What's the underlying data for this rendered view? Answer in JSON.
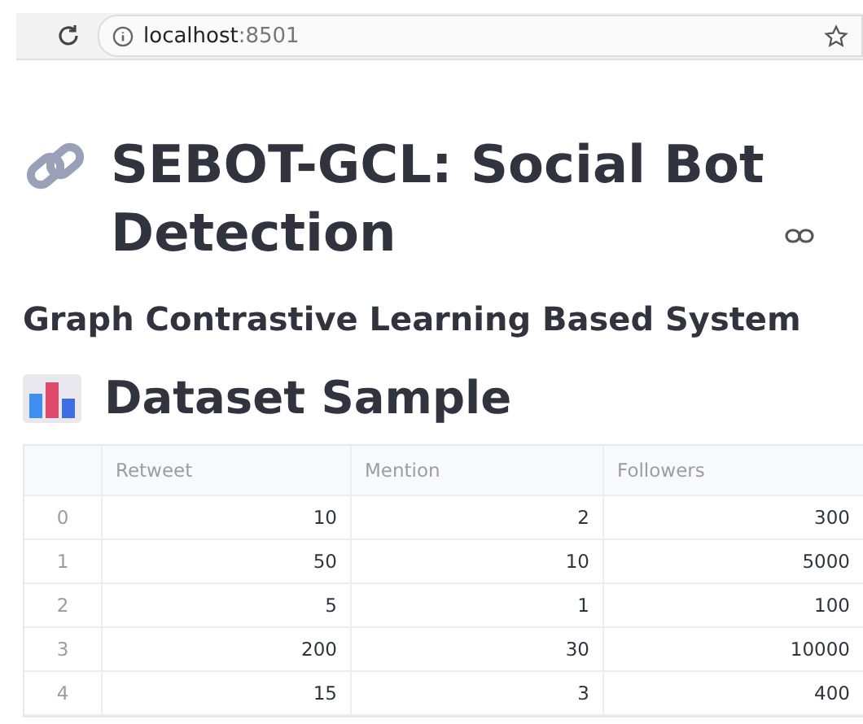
{
  "browser": {
    "url_host": "localhost",
    "url_port": ":8501"
  },
  "title": "SEBOT-GCL: Social Bot Detection",
  "subtitle": "Graph Contrastive Learning Based System",
  "section": {
    "title": "Dataset Sample"
  },
  "table": {
    "columns": [
      "Retweet",
      "Mention",
      "Followers"
    ],
    "rows": [
      {
        "index": "0",
        "cells": [
          "10",
          "2",
          "300"
        ]
      },
      {
        "index": "1",
        "cells": [
          "50",
          "10",
          "5000"
        ]
      },
      {
        "index": "2",
        "cells": [
          "5",
          "1",
          "100"
        ]
      },
      {
        "index": "3",
        "cells": [
          "200",
          "30",
          "10000"
        ]
      },
      {
        "index": "4",
        "cells": [
          "15",
          "3",
          "400"
        ]
      }
    ]
  }
}
